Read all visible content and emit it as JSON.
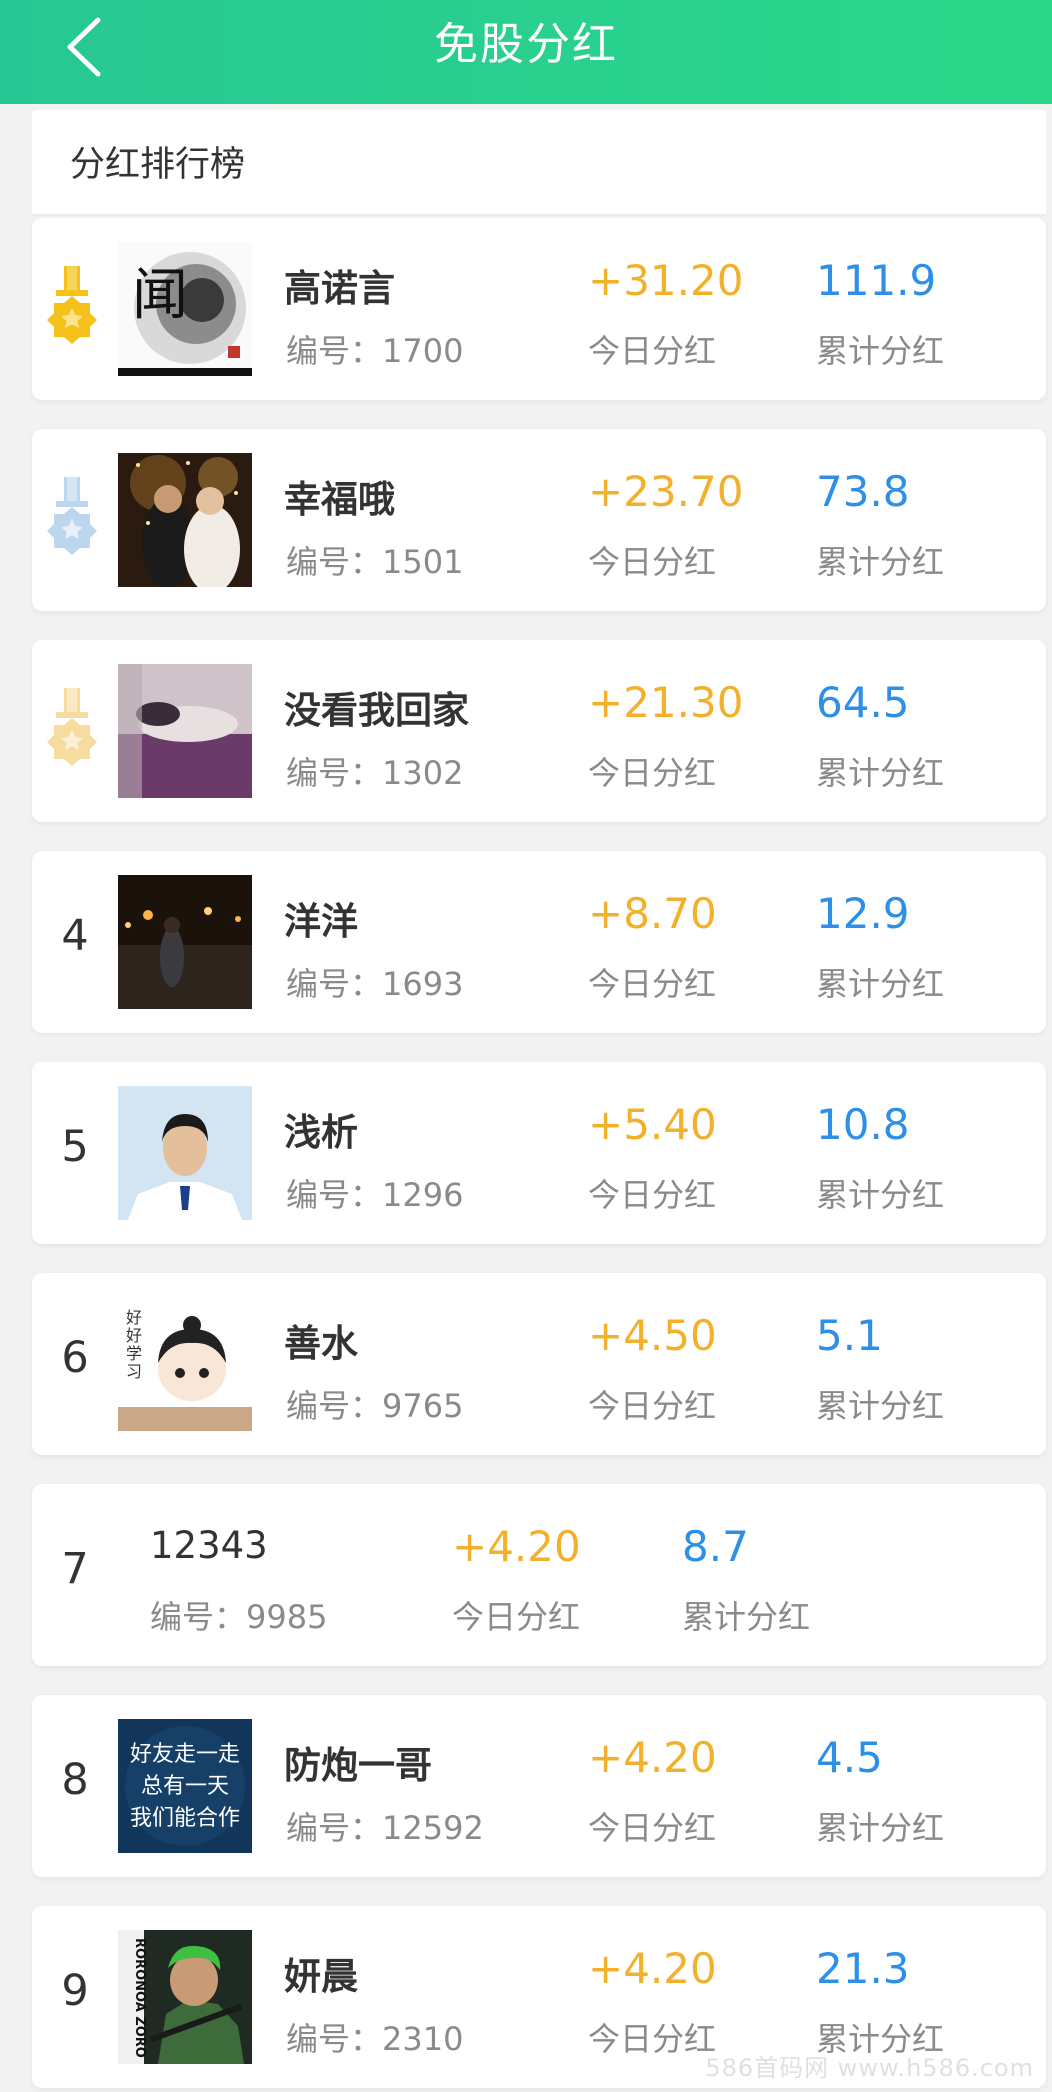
{
  "header": {
    "title": "免股分红"
  },
  "section": {
    "title": "分红排行榜"
  },
  "today_label": "今日分红",
  "total_label": "累计分红",
  "rows": [
    {
      "rank": "1",
      "medal": "gold-medal-icon",
      "name": "高诺言",
      "id_text": "编号：1700",
      "today": "+31.20",
      "total": "111.9"
    },
    {
      "rank": "2",
      "medal": "silver-medal-icon",
      "name": "幸福哦",
      "id_text": "编号：1501",
      "today": "+23.70",
      "total": "73.8"
    },
    {
      "rank": "3",
      "medal": "bronze-medal-icon",
      "name": "没看我回家",
      "id_text": "编号：1302",
      "today": "+21.30",
      "total": "64.5"
    },
    {
      "rank": "4",
      "name": "洋洋",
      "id_text": "编号：1693",
      "today": "+8.70",
      "total": "12.9"
    },
    {
      "rank": "5",
      "name": "浅析",
      "id_text": "编号：1296",
      "today": "+5.40",
      "total": "10.8"
    },
    {
      "rank": "6",
      "name": "善水",
      "id_text": "编号：9765",
      "today": "+4.50",
      "total": "5.1"
    },
    {
      "rank": "7",
      "name": "12343",
      "id_text": "编号：9985",
      "today": "+4.20",
      "total": "8.7"
    },
    {
      "rank": "8",
      "name": "防炮一哥",
      "id_text": "编号：12592",
      "today": "+4.20",
      "total": "4.5"
    },
    {
      "rank": "9",
      "name": "妍晨",
      "id_text": "编号：2310",
      "today": "+4.20",
      "total": "21.3"
    }
  ],
  "avatar_texts": {
    "row1": [
      "闻"
    ],
    "row6": [
      "好",
      "好",
      "学",
      "习"
    ],
    "row8": [
      "好友走一走",
      "总有一天",
      "我们能合作"
    ],
    "row9": [
      "RORONOA ZORO"
    ]
  },
  "watermark": "586首码网 www.h586.com",
  "colors": {
    "header_start": "#27c793",
    "header_end": "#2bd88a",
    "today_value": "#f2b02b",
    "total_value": "#2e8fe6",
    "gold_medal": "#f5c21b",
    "silver_medal": "#bcd6ee",
    "bronze_medal": "#f7dca0"
  }
}
